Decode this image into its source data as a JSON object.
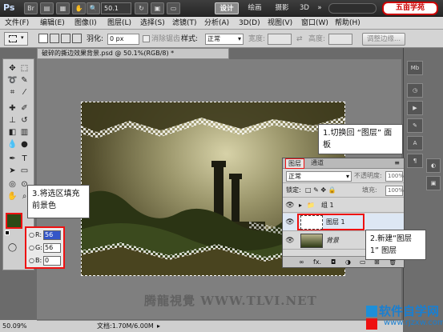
{
  "appbar": {
    "logo": "Ps",
    "zoom": "50.1",
    "workspaces": [
      "设计",
      "绘画",
      "摄影",
      "3D"
    ],
    "brand": "五亩学苑"
  },
  "menu": [
    "文件(F)",
    "编辑(E)",
    "图像(I)",
    "图层(L)",
    "选择(S)",
    "滤镜(T)",
    "分析(A)",
    "3D(D)",
    "视图(V)",
    "窗口(W)",
    "帮助(H)"
  ],
  "options": {
    "feather_label": "羽化:",
    "feather_value": "0 px",
    "antialias_label": "消除锯齿",
    "style_label": "样式:",
    "style_value": "正常",
    "width_label": "宽度:",
    "height_label": "高度:",
    "refine_button": "调整边缘..."
  },
  "document": {
    "tab_title": "破碎的撕边效果背景.psd @ 50.1%(RGB/8) *",
    "watermark": "腾龍視覺 WWW.TLVI.NET"
  },
  "layers_panel": {
    "tabs": [
      "图层",
      "通道"
    ],
    "blend_mode": "正常",
    "opacity_label": "不透明度:",
    "opacity_value": "100%",
    "lock_label": "锁定:",
    "fill_label": "填充:",
    "fill_value": "100%",
    "layers": [
      {
        "name": "组 1",
        "type": "group"
      },
      {
        "name": "图层 1",
        "type": "layer"
      },
      {
        "name": "背景",
        "type": "background"
      }
    ],
    "bottom_icons": [
      "fx.",
      "mask",
      "adjust",
      "folder",
      "new",
      "trash"
    ]
  },
  "color_picker": {
    "R_label": "R:",
    "R": "56",
    "G_label": "G:",
    "G": "56",
    "B_label": "B:",
    "B": "0"
  },
  "callouts": {
    "step1": "1.切换回 “图层” 面板",
    "step2": "2.新建“图层 1” 图层",
    "step3": "3.将选区填充前景色"
  },
  "statusbar": {
    "zoom": "50.09%",
    "doc_info": "文档:1.70M/6.00M"
  },
  "footer_logo": {
    "main": "软件自学网",
    "url": "www.rjzxw.com"
  },
  "colors": {
    "foreground": "#2c4a16",
    "highlight": "#e11111"
  }
}
